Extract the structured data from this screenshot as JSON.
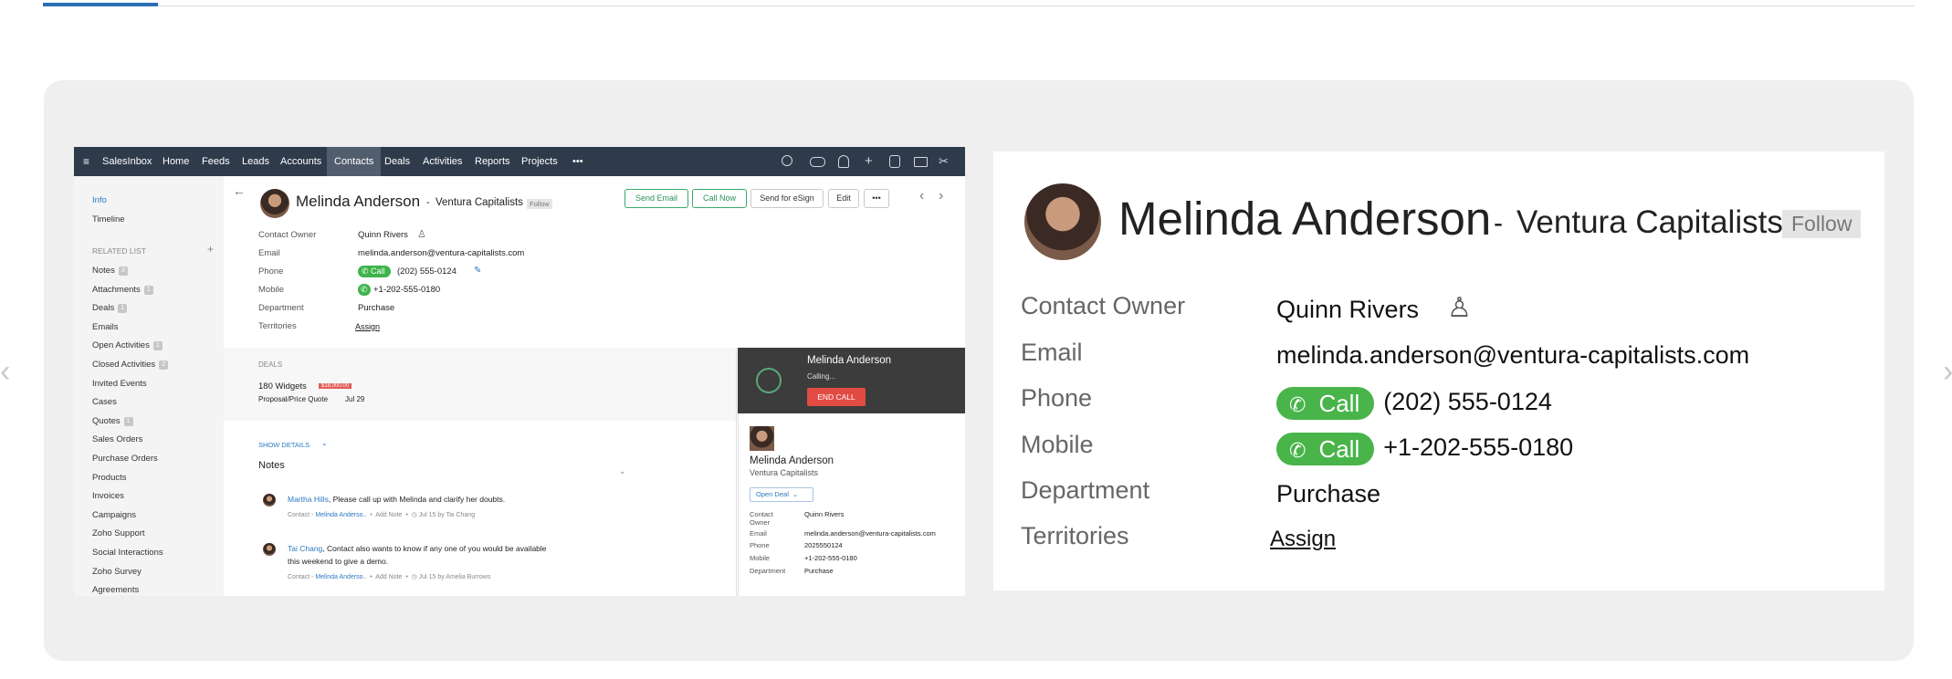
{
  "mini_app": {
    "nav": {
      "menu_icon": "hamburger-icon",
      "items": [
        "SalesInbox",
        "Home",
        "Feeds",
        "Leads",
        "Accounts",
        "Contacts",
        "Deals",
        "Activities",
        "Reports",
        "Projects"
      ],
      "more": "•••",
      "active": "Contacts",
      "right_icons": [
        "search-icon",
        "gamepad-icon",
        "bell-icon",
        "plus-icon",
        "notes-icon",
        "mail-icon",
        "tools-icon"
      ]
    },
    "sidebar": {
      "info": "Info",
      "timeline": "Timeline",
      "related_header": "RELATED LIST",
      "related_add": "+",
      "items": [
        {
          "label": "Notes",
          "badge": "3"
        },
        {
          "label": "Attachments",
          "badge": "1"
        },
        {
          "label": "Deals",
          "badge": "1"
        },
        {
          "label": "Emails",
          "badge": ""
        },
        {
          "label": "Open Activities",
          "badge": "1"
        },
        {
          "label": "Closed Activities",
          "badge": "2"
        },
        {
          "label": "Invited Events",
          "badge": ""
        },
        {
          "label": "Cases",
          "badge": ""
        },
        {
          "label": "Quotes",
          "badge": "1"
        },
        {
          "label": "Sales Orders",
          "badge": ""
        },
        {
          "label": "Purchase Orders",
          "badge": ""
        },
        {
          "label": "Products",
          "badge": ""
        },
        {
          "label": "Invoices",
          "badge": ""
        },
        {
          "label": "Campaigns",
          "badge": ""
        },
        {
          "label": "Zoho Support",
          "badge": ""
        },
        {
          "label": "Social Interactions",
          "badge": ""
        },
        {
          "label": "Zoho Survey",
          "badge": ""
        },
        {
          "label": "Agreements",
          "badge": ""
        }
      ]
    },
    "header": {
      "name": "Melinda Anderson",
      "separator": "-",
      "company": "Ventura Capitalists",
      "follow": "Follow",
      "buttons": {
        "send_email": "Send Email",
        "call_now": "Call Now",
        "send_esign": "Send for eSign",
        "edit": "Edit",
        "more": "•••"
      }
    },
    "fields": [
      {
        "label": "Contact Owner",
        "value": "Quinn Rivers"
      },
      {
        "label": "Email",
        "value": "melinda.anderson@ventura-capitalists.com"
      },
      {
        "label": "Phone",
        "value": "(202) 555-0124",
        "call": "Call"
      },
      {
        "label": "Mobile",
        "value": "+1-202-555-0180"
      },
      {
        "label": "Department",
        "value": "Purchase"
      },
      {
        "label": "Territories",
        "value": "Assign"
      }
    ],
    "deals": {
      "header": "DEALS",
      "name": "180 Widgets",
      "amount": "$18,000.00",
      "stage": "Proposal/Price Quote",
      "date": "Jul 29"
    },
    "show_details": "SHOW DETAILS",
    "notes": {
      "title": "Notes",
      "items": [
        {
          "author": "Martha Hills",
          "text": ", Please call up with Melinda and clarify her doubts.",
          "meta_prefix": "Contact -",
          "contact": "Melinda Anderso..",
          "add_note": "Add Note",
          "date": "Jul 15 by Tai Chang"
        },
        {
          "author": "Tai Chang",
          "text": ", Contact also wants to know if any one of you would be available",
          "text2": "this weekend to give a demo.",
          "meta_prefix": "Contact -",
          "contact": "Melinda Anderso..",
          "add_note": "Add Note",
          "date": "Jul 15 by Amelia Burrows"
        }
      ]
    },
    "call_panel": {
      "name": "Melinda Anderson",
      "status": "Calling...",
      "end": "END CALL"
    },
    "contact_panel": {
      "name": "Melinda Anderson",
      "company": "Ventura Capitalists",
      "open_deal": "Open Deal",
      "fields": [
        {
          "label": "Contact",
          "label2": "Owner",
          "value": "Quinn Rivers"
        },
        {
          "label": "Email",
          "value": "melinda.anderson@ventura-capitalists.com"
        },
        {
          "label": "Phone",
          "value": "2025550124"
        },
        {
          "label": "Mobile",
          "value": "+1-202-555-0180"
        },
        {
          "label": "Department",
          "value": "Purchase"
        }
      ]
    }
  },
  "zoom": {
    "name": "Melinda Anderson",
    "separator": "-",
    "company": "Ventura Capitalists",
    "follow": "Follow",
    "call_label": "Call",
    "fields": [
      {
        "label": "Contact Owner",
        "value": "Quinn Rivers"
      },
      {
        "label": "Email",
        "value": "melinda.anderson@ventura-capitalists.com"
      },
      {
        "label": "Phone",
        "value": "(202) 555-0124"
      },
      {
        "label": "Mobile",
        "value": "+1-202-555-0180"
      },
      {
        "label": "Department",
        "value": "Purchase"
      },
      {
        "label": "Territories",
        "value": "Assign"
      }
    ]
  },
  "carousel": {
    "prev": "‹",
    "next": "›"
  },
  "colors": {
    "accent": "#2c6fb5",
    "call_green": "#48b44a",
    "end_call": "#e24b44",
    "nav_bg": "#2f3a4b"
  }
}
